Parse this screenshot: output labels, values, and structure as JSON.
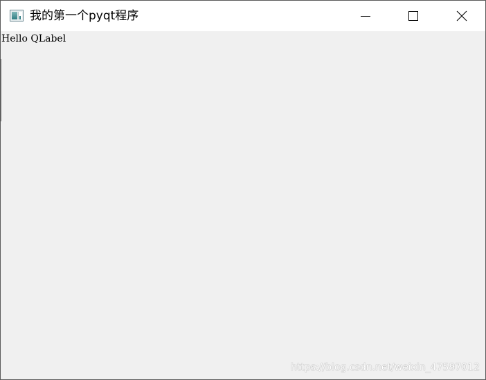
{
  "window": {
    "title": "我的第一个pyqt程序",
    "controls": {
      "minimize": "minimize-icon",
      "maximize": "maximize-icon",
      "close": "close-icon"
    }
  },
  "content": {
    "label_text": "Hello QLabel"
  },
  "watermark": {
    "text": "https://blog.csdn.net/weixin_47597012"
  },
  "colors": {
    "titlebar": "#ffffff",
    "client_background": "#f0f0f0",
    "border": "#5a5a5a"
  }
}
